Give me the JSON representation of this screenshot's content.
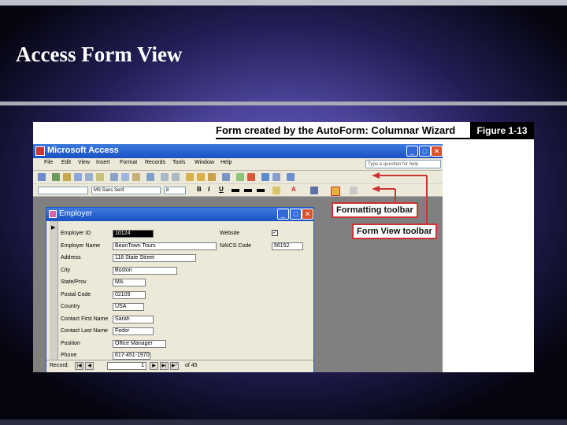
{
  "slide": {
    "title": "Access Form View"
  },
  "figure": {
    "caption": "Form created by the AutoForm: Columnar Wizard",
    "label": "Figure 1-13"
  },
  "app": {
    "title": "Microsoft Access",
    "menu": [
      "File",
      "Edit",
      "View",
      "Insert",
      "Format",
      "Records",
      "Tools",
      "Window",
      "Help"
    ],
    "ask_placeholder": "Type a question for help",
    "font_name": "MS Sans Serif",
    "font_size": "8",
    "window_buttons": {
      "minimize": "_",
      "maximize": "□",
      "close": "✕"
    }
  },
  "form_window": {
    "title": "Employer",
    "fields": [
      {
        "label": "Employer ID",
        "value": "10124"
      },
      {
        "label": "Employer Name",
        "value": "BeanTown Tours"
      },
      {
        "label": "Address",
        "value": "118 State Street"
      },
      {
        "label": "City",
        "value": "Boston"
      },
      {
        "label": "State/Prov",
        "value": "MA"
      },
      {
        "label": "Postal Code",
        "value": "02109"
      },
      {
        "label": "Country",
        "value": "USA"
      },
      {
        "label": "Contact First Name",
        "value": "Sarah"
      },
      {
        "label": "Contact Last Name",
        "value": "Fedor"
      },
      {
        "label": "Position",
        "value": "Office Manager"
      },
      {
        "label": "Phone",
        "value": "617-451-1970"
      }
    ],
    "website_label": "Website",
    "website_checked": "✓",
    "naics_label": "NAICS Code",
    "naics_value": "56152",
    "nav": {
      "label": "Record:",
      "current": "1",
      "total_text": "of 45"
    }
  },
  "callouts": {
    "formatting": "Formatting toolbar",
    "formview": "Form View toolbar"
  },
  "colors": {
    "callout_border": "#cc3333",
    "title_bar": "#1951c4"
  }
}
